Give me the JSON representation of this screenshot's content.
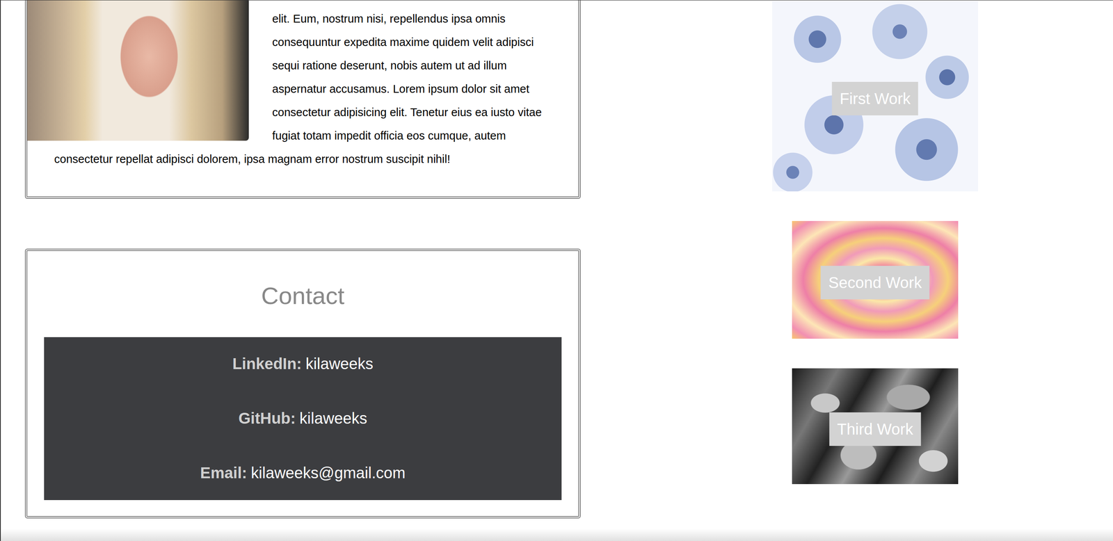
{
  "about": {
    "text": "elit. Eum, nostrum nisi, repellendus ipsa omnis consequuntur expedita maxime quidem velit adipisci sequi ratione deserunt, nobis autem ut ad illum aspernatur accusamus. Lorem ipsum dolor sit amet consectetur adipisicing elit. Tenetur eius ea iusto vitae fugiat totam impedit officia eos cumque, autem consectetur repellat adipisci dolorem, ipsa magnam error nostrum suscipit nihil!"
  },
  "contact": {
    "title": "Contact",
    "items": [
      {
        "label": "LinkedIn:",
        "value": "kilaweeks"
      },
      {
        "label": "GitHub:",
        "value": "kilaweeks"
      },
      {
        "label": "Email:",
        "value": "kilaweeks@gmail.com"
      }
    ]
  },
  "works": [
    {
      "label": "First Work"
    },
    {
      "label": "Second Work"
    },
    {
      "label": "Third Work"
    }
  ]
}
